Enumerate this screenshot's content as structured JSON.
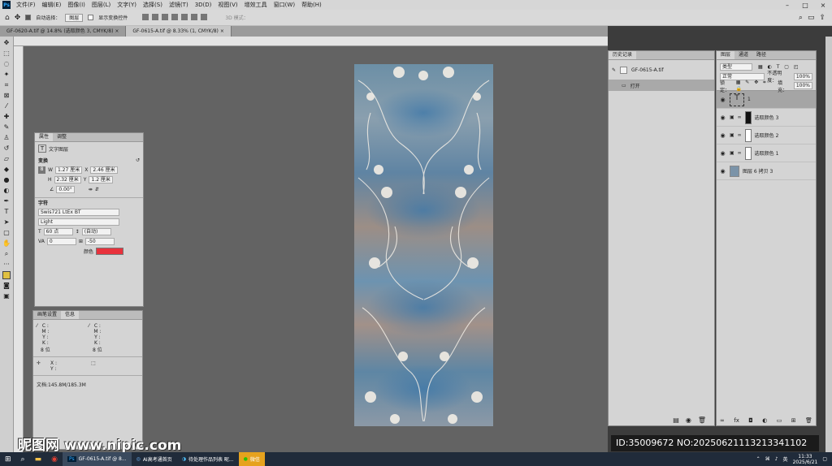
{
  "menubar": {
    "logo": "Ps",
    "items": [
      "文件(F)",
      "编辑(E)",
      "图像(I)",
      "图层(L)",
      "文字(Y)",
      "选择(S)",
      "滤镜(T)",
      "3D(D)",
      "视图(V)",
      "增效工具",
      "窗口(W)",
      "帮助(H)"
    ]
  },
  "options": {
    "auto_select_label": "自动选择：",
    "auto_select_target": "图层",
    "show_transform_label": "显示变换控件",
    "mode_label": "3D 模式："
  },
  "tabs": [
    {
      "label": "GF-0620-A.tif @ 14.8% (选取颜色 3, CMYK/8)",
      "close": "×"
    },
    {
      "label": "GF-0615-A.tif @ 8.33% (1, CMYK/8)",
      "close": "×"
    }
  ],
  "properties": {
    "tabs": [
      "属性",
      "调整"
    ],
    "kind": "文字图层",
    "transform_title": "变换",
    "w_label": "W",
    "w_value": "1.27 厘米",
    "x_label": "X",
    "x_value": "2.46 厘米",
    "h_label": "H",
    "h_value": "2.32 厘米",
    "y_label": "Y",
    "y_value": "1.2 厘米",
    "angle_value": "0.00°",
    "char_title": "字符",
    "font_family": "Swis721 LtEx BT",
    "font_style": "Light",
    "font_size": "60 点",
    "leading": "(自动)",
    "kerning": "0",
    "tracking": "-50",
    "color_label": "颜色",
    "color_hex": "#e8323c"
  },
  "info": {
    "tabs": [
      "画笔设置",
      "信息"
    ],
    "c1": "C :",
    "m1": "M :",
    "y1": "Y :",
    "k1": "K :",
    "bits1": "8 位",
    "c2": "C :",
    "m2": "M :",
    "y2": "Y :",
    "k2": "K :",
    "bits2": "8 位",
    "x": "X :",
    "y": "Y :",
    "doc": "文档:145.8M/185.3M"
  },
  "history": {
    "title": "历史记录",
    "snapshot": "GF-0615-A.tif",
    "open_label": "打开"
  },
  "layers": {
    "tabs": [
      "图层",
      "通道",
      "路径"
    ],
    "filter": "类型",
    "blend_mode": "正常",
    "opacity_label": "不透明度：",
    "opacity_value": "100%",
    "lock_label": "锁定：",
    "fill_label": "填充：",
    "fill_value": "100%",
    "items": [
      {
        "name": "1",
        "kind": "text"
      },
      {
        "name": "选取颜色 3",
        "kind": "adj"
      },
      {
        "name": "选取颜色 2",
        "kind": "adj"
      },
      {
        "name": "选取颜色 1",
        "kind": "adj"
      },
      {
        "name": "图层 6 拷贝 3",
        "kind": "pixel"
      }
    ]
  },
  "taskbar": {
    "ps_task": "GF-0615-A.tif @ 8...",
    "ai_task": "AI高考通首页",
    "work_task": "待处理作品列表 昵...",
    "wechat_task": "微信",
    "lang": "英",
    "time": "11:33",
    "date": "2025/6/21"
  },
  "watermark": {
    "left": "昵图网 www.nipic.com",
    "right": "ID:35009672 NO:20250621113213341102"
  },
  "colors": {
    "accent": "#e8323c"
  }
}
